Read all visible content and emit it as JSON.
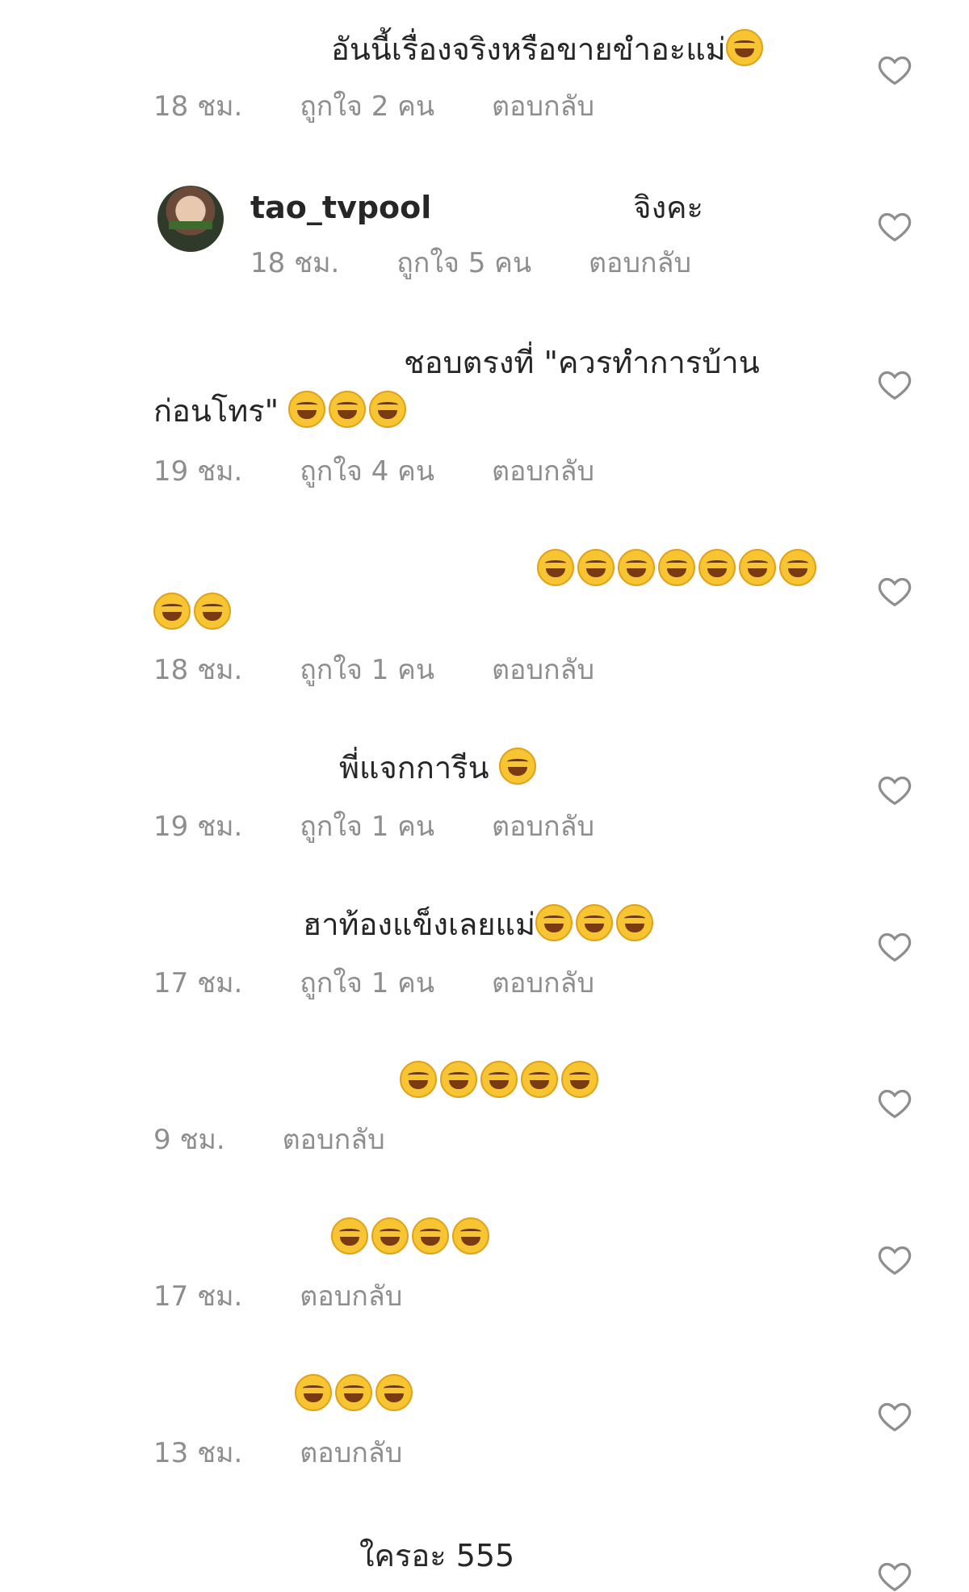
{
  "comments": [
    {
      "text": "อันนี้เรื่องจริงหรือขายขำอะแม่",
      "emoji_count": 1,
      "time": "18 ชม.",
      "likes": "ถูกใจ 2 คน",
      "reply": "ตอบกลับ"
    },
    {
      "username": "tao_tvpool",
      "text": "จิงคะ",
      "emoji_count": 0,
      "time": "18 ชม.",
      "likes": "ถูกใจ 5 คน",
      "reply": "ตอบกลับ"
    },
    {
      "text": "ชอบตรงที่ \"ควรทำการบ้าน",
      "text2": "ก่อนโทร\"",
      "emoji_count": 3,
      "time": "19 ชม.",
      "likes": "ถูกใจ 4 คน",
      "reply": "ตอบกลับ"
    },
    {
      "text": "",
      "emoji_count": 9,
      "time": "18 ชม.",
      "likes": "ถูกใจ 1 คน",
      "reply": "ตอบกลับ"
    },
    {
      "text": "พี่แจกการีน",
      "emoji_count": 1,
      "time": "19 ชม.",
      "likes": "ถูกใจ 1 คน",
      "reply": "ตอบกลับ"
    },
    {
      "text": "ฮาท้องแข็งเลยแม่",
      "emoji_count": 3,
      "time": "17 ชม.",
      "likes": "ถูกใจ 1 คน",
      "reply": "ตอบกลับ"
    },
    {
      "text": "",
      "emoji_count": 5,
      "time": "9 ชม.",
      "reply": "ตอบกลับ"
    },
    {
      "text": "",
      "emoji_count": 4,
      "time": "17 ชม.",
      "reply": "ตอบกลับ"
    },
    {
      "text": "",
      "emoji_count": 3,
      "time": "13 ชม.",
      "reply": "ตอบกลับ"
    },
    {
      "text": "ใครอะ 555",
      "emoji_count": 0
    }
  ],
  "icons": {
    "like": "heart-outline-icon",
    "emoji": "face-with-tears-of-joy-icon"
  },
  "colors": {
    "text": "#262626",
    "meta": "#8e8e8e",
    "heart": "#8e8e8e"
  }
}
